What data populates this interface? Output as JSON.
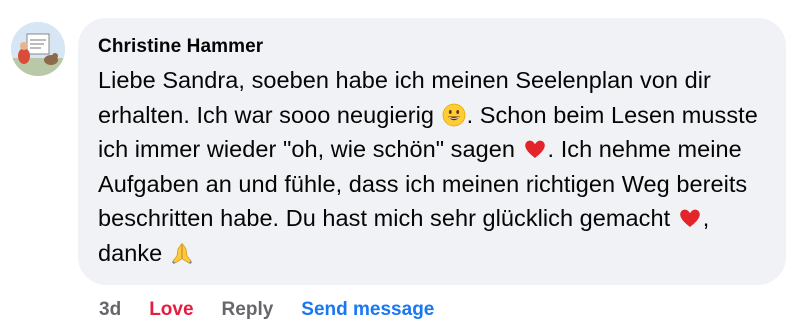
{
  "comment": {
    "author": "Christine Hammer",
    "text_parts": [
      "Liebe Sandra, soeben habe ich meinen Seelenplan von dir erhalten. Ich war sooo neugierig ",
      ". Schon beim Lesen musste ich immer wieder \"oh, wie schön\" sagen ",
      ". Ich nehme meine Aufgaben an und fühle, dass ich meinen richtigen Weg bereits beschritten habe. Du hast mich sehr glücklich gemacht ",
      ", danke "
    ],
    "emojis": [
      "grinning-face-emoji",
      "red-heart-emoji",
      "red-heart-emoji",
      "folded-hands-emoji"
    ]
  },
  "actions": {
    "timestamp": "3d",
    "love_label": "Love",
    "reply_label": "Reply",
    "send_label": "Send message"
  },
  "colors": {
    "bubble_bg": "#f0f2f5",
    "love": "#e41e3f",
    "send": "#1877f2",
    "muted": "#65676b"
  }
}
